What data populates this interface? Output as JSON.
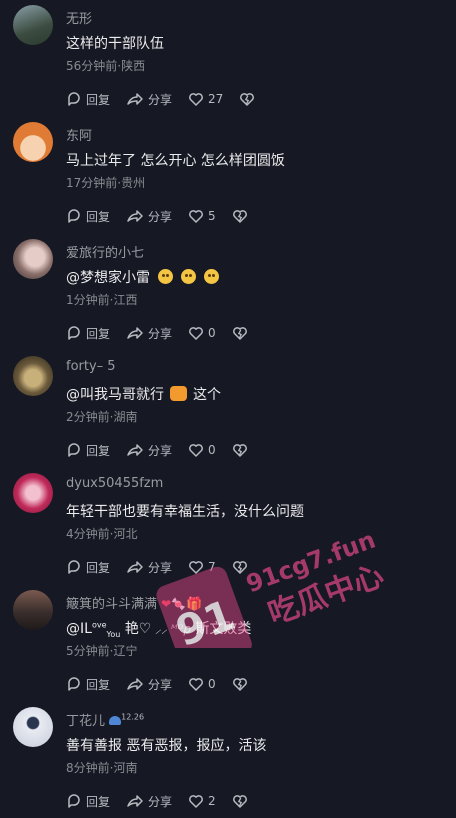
{
  "labels": {
    "reply": "回复",
    "share": "分享"
  },
  "comments": [
    {
      "name": "无形",
      "text": "这样的干部队伍",
      "meta": "56分钟前·陕西",
      "likes": "27",
      "avatar_color": "#5a6a5e"
    },
    {
      "name": "东阿",
      "text": "马上过年了 怎么开心 怎么样团圆饭",
      "meta": "17分钟前·贵州",
      "likes": "5",
      "avatar_color": "#e07b35"
    },
    {
      "name": "爱旅行的小七",
      "text": "@梦想家小雷",
      "meta": "1分钟前·江西",
      "likes": "0",
      "avatar_color": "#c9a8a2"
    },
    {
      "name": "forty– 5",
      "text_prefix": "@叫我马哥就行",
      "text_suffix": "这个",
      "meta": "2分钟前·湖南",
      "likes": "0",
      "avatar_color": "#6b5a3c"
    },
    {
      "name": "dyux50455fzm",
      "text": "年轻干部也要有幸福生活，没什么问题",
      "meta": "4分钟前·河北",
      "likes": "7",
      "avatar_color": "#c02a5a"
    },
    {
      "name": "簸箕的斗斗满满",
      "text_a": "@IL",
      "text_sup": "ove",
      "text_sub": "You",
      "text_b": "艳♡",
      "text_c": "斯文败类",
      "meta": "5分钟前·辽宁",
      "likes": "0",
      "avatar_color": "#4a3a38"
    },
    {
      "name": "丁花儿",
      "badge": "12.26",
      "text": "善有善报 恶有恶报，报应，活该",
      "meta": "8分钟前·河南",
      "likes": "2",
      "avatar_color": "#d9dde6"
    }
  ],
  "watermark": {
    "line1": "91cg7.fun",
    "line2": "吃瓜中心",
    "logo": "91"
  }
}
